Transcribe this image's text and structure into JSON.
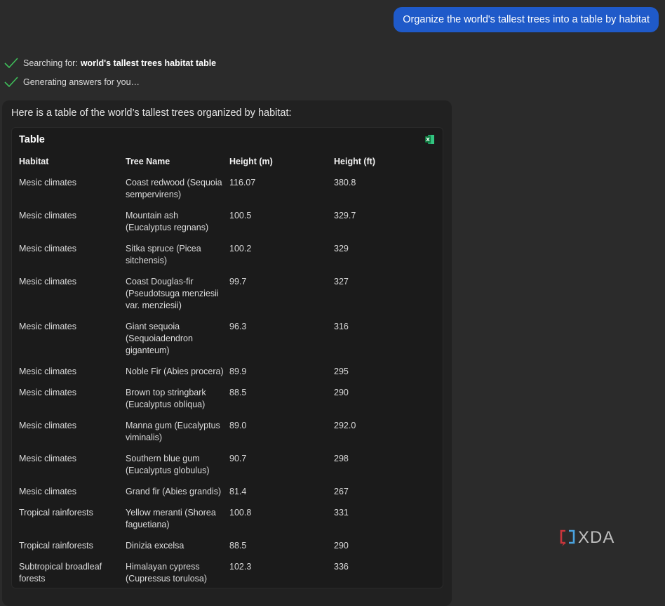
{
  "user_message": "Organize the world's tallest trees into a table by habitat",
  "status": {
    "searching_label": "Searching for:",
    "searching_query": "world's tallest trees habitat table",
    "generating": "Generating answers for you…"
  },
  "answer": {
    "intro": "Here is a table of the world’s tallest trees organized by habitat:",
    "table_title": "Table",
    "export_icon": "excel-icon",
    "columns": [
      "Habitat",
      "Tree Name",
      "Height (m)",
      "Height (ft)"
    ],
    "rows": [
      [
        "Mesic climates",
        "Coast redwood (Sequoia sempervirens)",
        "116.07",
        "380.8"
      ],
      [
        "Mesic climates",
        "Mountain ash (Eucalyptus regnans)",
        "100.5",
        "329.7"
      ],
      [
        "Mesic climates",
        "Sitka spruce (Picea sitchensis)",
        "100.2",
        "329"
      ],
      [
        "Mesic climates",
        "Coast Douglas-fir (Pseudotsuga menziesii var. menziesii)",
        "99.7",
        "327"
      ],
      [
        "Mesic climates",
        "Giant sequoia (Sequoiadendron giganteum)",
        "96.3",
        "316"
      ],
      [
        "Mesic climates",
        "Noble Fir (Abies procera)",
        "89.9",
        "295"
      ],
      [
        "Mesic climates",
        "Brown top stringbark (Eucalyptus obliqua)",
        "88.5",
        "290"
      ],
      [
        "Mesic climates",
        "Manna gum (Eucalyptus viminalis)",
        "89.0",
        "292.0"
      ],
      [
        "Mesic climates",
        "Southern blue gum (Eucalyptus globulus)",
        "90.7",
        "298"
      ],
      [
        "Mesic climates",
        "Grand fir (Abies grandis)",
        "81.4",
        "267"
      ],
      [
        "Tropical rainforests",
        "Yellow meranti (Shorea faguetiana)",
        "100.8",
        "331"
      ],
      [
        "Tropical rainforests",
        "Dinizia excelsa",
        "88.5",
        "290"
      ],
      [
        "Subtropical broadleaf forests",
        "Himalayan cypress (Cupressus torulosa)",
        "102.3",
        "336"
      ]
    ]
  },
  "watermark": {
    "text": "XDA"
  },
  "colors": {
    "background": "#2b2b2b",
    "user_bubble": "#1f5ac9",
    "check": "#3fbf5a",
    "card": "#212121",
    "table_panel": "#1b1b1b"
  }
}
